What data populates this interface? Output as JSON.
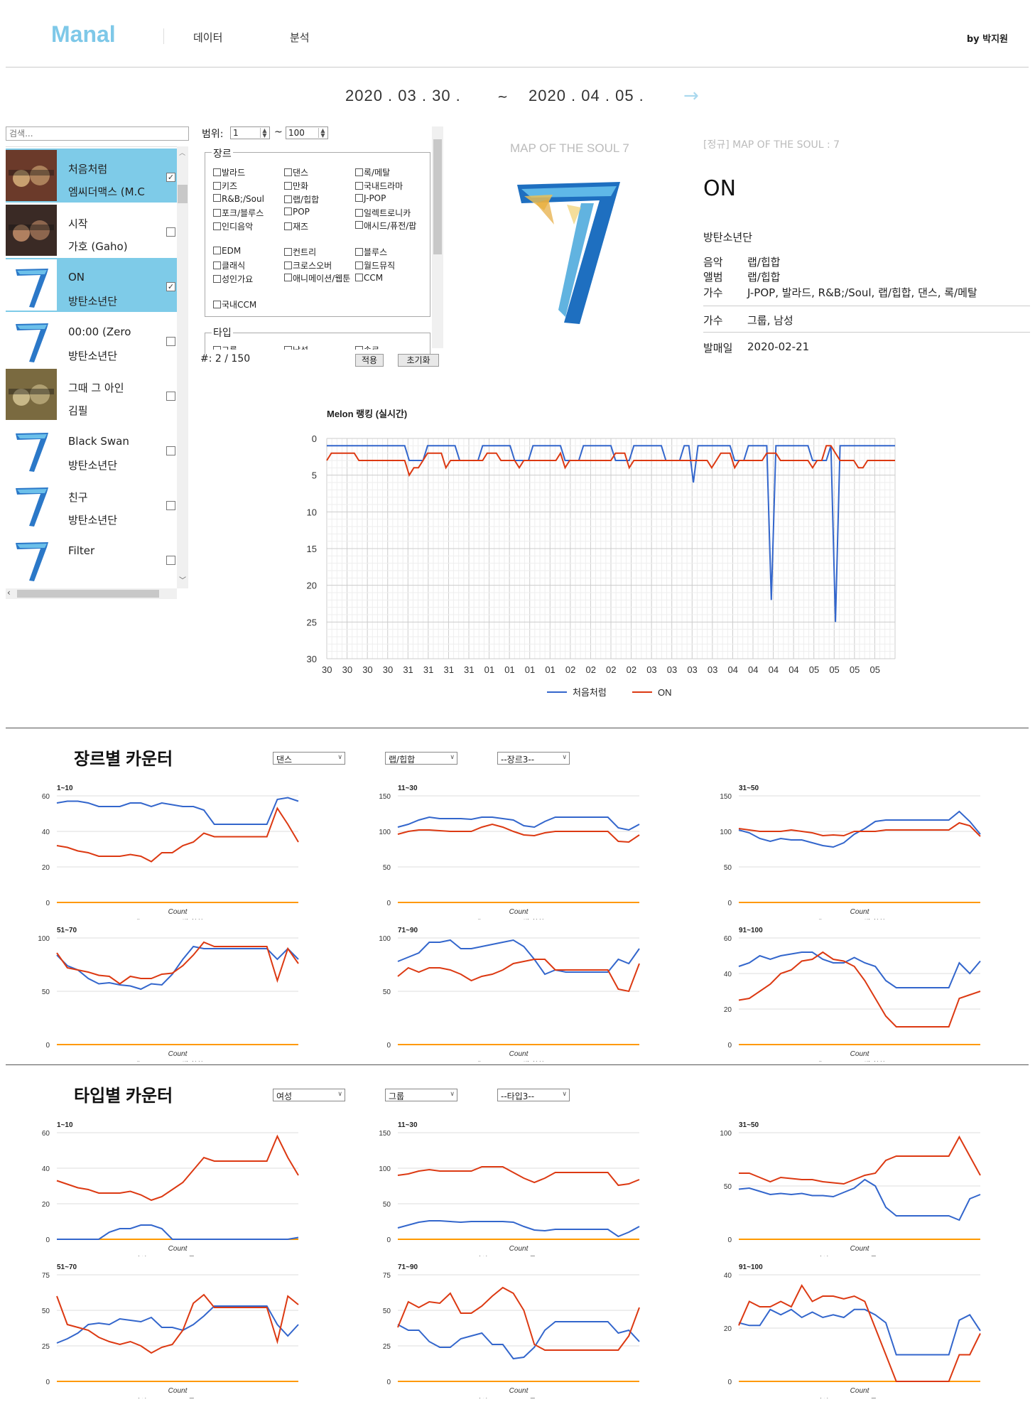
{
  "header": {
    "logo": "Manal",
    "nav": [
      "데이터",
      "분석"
    ],
    "author": "by 박지원"
  },
  "date_range": {
    "start": "2020 .  03 .  30 .",
    "separator": "~",
    "end": "2020 .  04 .  05 .",
    "arrow": "→"
  },
  "search": {
    "placeholder": "검색..."
  },
  "songs": [
    {
      "title": "처음처럼",
      "artist": "엠씨더맥스 (M.C",
      "selected": true,
      "checked": true
    },
    {
      "title": "시작",
      "artist": "가호 (Gaho)",
      "selected": false,
      "checked": false
    },
    {
      "title": "ON",
      "artist": "방탄소년단",
      "selected": true,
      "checked": true
    },
    {
      "title": "00:00 (Zero",
      "artist": "방탄소년단",
      "selected": false,
      "checked": false
    },
    {
      "title": "그때 그 아인",
      "artist": "김필",
      "selected": false,
      "checked": false
    },
    {
      "title": "Black Swan",
      "artist": "방탄소년단",
      "selected": false,
      "checked": false
    },
    {
      "title": "친구",
      "artist": "방탄소년단",
      "selected": false,
      "checked": false
    },
    {
      "title": "Filter",
      "artist": "",
      "selected": false,
      "checked": false
    }
  ],
  "filter": {
    "range_label": "범위:",
    "range_from": "1",
    "range_tilde": "~",
    "range_to": "100",
    "genre_label": "장르",
    "genres": [
      [
        "발라드",
        "댄스",
        "록/메탈"
      ],
      [
        "키즈",
        "만화",
        "국내드라마"
      ],
      [
        "R&B;/Soul",
        "랩/힙합",
        "J-POP"
      ],
      [
        "포크/블루스",
        "POP",
        "일렉트로니카"
      ],
      [
        "인디음악",
        "재즈",
        "애시드/퓨전/팝"
      ],
      [
        "EDM",
        "컨트리",
        "블루스"
      ],
      [
        "클래식",
        "크로스오버",
        "월드뮤직"
      ],
      [
        "성인가요",
        "애니메이션/웹툰",
        "CCM"
      ],
      [
        "국내CCM",
        "",
        ""
      ]
    ],
    "type_label": "타입",
    "type_partial": [
      "그룹",
      "남성",
      "솔로"
    ],
    "count": "#: 2 / 150",
    "apply": "적용",
    "reset": "초기화"
  },
  "detail": {
    "album_art_text": "MAP OF THE SOUL  7",
    "tag": "[정규] MAP OF THE SOUL : 7",
    "title": "ON",
    "artist": "방탄소년단",
    "rows": [
      {
        "k": "음악",
        "v": "랩/힙합"
      },
      {
        "k": "앨범",
        "v": "랩/힙합"
      },
      {
        "k": "가수",
        "v": "J-POP, 발라드, R&B;/Soul, 랩/힙합, 댄스, 록/메탈"
      }
    ],
    "type_row": {
      "k": "가수",
      "v": "그룹, 남성"
    },
    "release_row": {
      "k": "발매일",
      "v": "2020-02-21"
    }
  },
  "colors": {
    "blue": "#3366cc",
    "red": "#dc3912",
    "orange": "#ff9900",
    "accent": "#7ecbe8"
  },
  "chart_data": [
    {
      "id": "ranking",
      "type": "line",
      "title": "Melon 랭킹 (실시간)",
      "ylim": [
        0,
        30
      ],
      "y_inverted": true,
      "yticks": [
        0,
        5,
        10,
        15,
        20,
        25,
        30
      ],
      "xticks": [
        "30",
        "30",
        "30",
        "30",
        "31",
        "31",
        "31",
        "31",
        "01",
        "01",
        "01",
        "01",
        "02",
        "02",
        "02",
        "02",
        "03",
        "03",
        "03",
        "03",
        "04",
        "04",
        "04",
        "04",
        "05",
        "05",
        "05",
        "05"
      ],
      "series": [
        {
          "name": "처음처럼",
          "color": "#3366cc",
          "values": [
            1,
            1,
            1,
            1,
            1,
            1,
            1,
            1,
            1,
            1,
            1,
            1,
            1,
            1,
            1,
            1,
            1,
            1,
            3,
            3,
            3,
            3,
            1,
            1,
            1,
            1,
            1,
            1,
            1,
            3,
            3,
            3,
            3,
            3,
            1,
            1,
            1,
            1,
            1,
            1,
            1,
            3,
            3,
            3,
            3,
            1,
            1,
            1,
            1,
            1,
            1,
            1,
            3,
            3,
            3,
            3,
            1,
            1,
            1,
            1,
            1,
            1,
            1,
            3,
            3,
            3,
            3,
            1,
            1,
            1,
            1,
            1,
            1,
            1,
            3,
            3,
            3,
            3,
            1,
            1,
            6,
            1,
            1,
            1,
            1,
            1,
            1,
            1,
            1,
            3,
            3,
            3,
            1,
            1,
            1,
            1,
            1,
            22,
            1,
            1,
            1,
            1,
            1,
            1,
            1,
            1,
            3,
            3,
            3,
            3,
            1,
            25,
            1,
            1,
            1,
            1,
            1,
            1,
            1,
            1,
            1,
            1,
            1,
            1,
            1
          ]
        },
        {
          "name": "ON",
          "color": "#dc3912",
          "values": [
            3,
            2,
            2,
            2,
            2,
            2,
            2,
            3,
            3,
            3,
            3,
            3,
            3,
            3,
            3,
            3,
            3,
            3,
            5,
            4,
            4,
            3,
            2,
            2,
            2,
            2,
            4,
            3,
            3,
            3,
            3,
            3,
            3,
            3,
            3,
            2,
            2,
            2,
            3,
            3,
            3,
            3,
            4,
            3,
            3,
            3,
            3,
            3,
            3,
            3,
            3,
            2,
            4,
            3,
            3,
            3,
            3,
            3,
            3,
            3,
            3,
            3,
            3,
            2,
            2,
            2,
            4,
            3,
            3,
            3,
            3,
            3,
            3,
            3,
            3,
            3,
            3,
            3,
            3,
            3,
            3,
            3,
            3,
            3,
            4,
            3,
            2,
            2,
            2,
            4,
            3,
            3,
            3,
            3,
            3,
            3,
            2,
            2,
            2,
            3,
            3,
            3,
            3,
            3,
            3,
            3,
            4,
            3,
            3,
            1,
            1,
            2,
            3,
            3,
            3,
            3,
            4,
            4,
            3,
            3,
            3,
            3,
            3,
            3,
            3
          ]
        }
      ]
    }
  ],
  "genre_section": {
    "title": "장르별 카운터",
    "selects": [
      "댄스",
      "랩/힙합",
      "--장르3--"
    ],
    "legend": [
      "댄스",
      "랩/힙합",
      ""
    ],
    "xlabel": "Count",
    "charts": [
      {
        "title": "1~10",
        "ymax": 60,
        "yticks": [
          0,
          20,
          40,
          60
        ],
        "s1": [
          56,
          57,
          57,
          56,
          54,
          54,
          54,
          56,
          56,
          54,
          56,
          55,
          54,
          54,
          52,
          44,
          44,
          44,
          44,
          44,
          44,
          58,
          59,
          57
        ],
        "s2": [
          32,
          31,
          29,
          28,
          26,
          26,
          26,
          27,
          26,
          23,
          28,
          28,
          32,
          34,
          39,
          37,
          37,
          37,
          37,
          37,
          37,
          53,
          44,
          34
        ]
      },
      {
        "title": "11~30",
        "ymax": 150,
        "yticks": [
          0,
          50,
          100,
          150
        ],
        "s1": [
          106,
          110,
          116,
          120,
          118,
          118,
          118,
          117,
          120,
          120,
          118,
          116,
          108,
          106,
          114,
          120,
          120,
          120,
          120,
          120,
          120,
          105,
          102,
          110
        ],
        "s2": [
          96,
          100,
          102,
          102,
          101,
          100,
          100,
          100,
          106,
          110,
          106,
          100,
          95,
          94,
          98,
          100,
          100,
          100,
          100,
          100,
          100,
          86,
          85,
          95
        ]
      },
      {
        "title": "31~50",
        "ymax": 150,
        "yticks": [
          0,
          50,
          100,
          150
        ],
        "s1": [
          102,
          98,
          90,
          86,
          90,
          88,
          88,
          84,
          80,
          78,
          84,
          96,
          104,
          114,
          116,
          116,
          116,
          116,
          116,
          116,
          116,
          128,
          114,
          96
        ],
        "s2": [
          104,
          102,
          100,
          100,
          100,
          102,
          100,
          98,
          94,
          95,
          94,
          100,
          100,
          100,
          102,
          102,
          102,
          102,
          102,
          102,
          102,
          112,
          108,
          93
        ]
      },
      {
        "title": "51~70",
        "ymax": 100,
        "yticks": [
          0,
          50,
          100
        ],
        "s1": [
          84,
          74,
          70,
          62,
          57,
          58,
          56,
          55,
          52,
          57,
          56,
          66,
          80,
          92,
          90,
          90,
          90,
          90,
          90,
          90,
          90,
          80,
          90,
          80
        ],
        "s2": [
          86,
          72,
          70,
          68,
          65,
          64,
          57,
          64,
          62,
          62,
          66,
          67,
          74,
          84,
          96,
          92,
          92,
          92,
          92,
          92,
          92,
          60,
          90,
          76
        ]
      },
      {
        "title": "71~90",
        "ymax": 100,
        "yticks": [
          0,
          50,
          100
        ],
        "s1": [
          78,
          82,
          86,
          96,
          96,
          98,
          90,
          90,
          92,
          94,
          96,
          98,
          92,
          80,
          66,
          70,
          68,
          68,
          68,
          68,
          68,
          80,
          76,
          90
        ],
        "s2": [
          64,
          72,
          68,
          72,
          72,
          70,
          66,
          60,
          64,
          66,
          70,
          76,
          78,
          80,
          80,
          70,
          70,
          70,
          70,
          70,
          70,
          52,
          50,
          76
        ]
      },
      {
        "title": "91~100",
        "ymax": 60,
        "yticks": [
          0,
          20,
          40,
          60
        ],
        "s1": [
          44,
          46,
          50,
          48,
          50,
          51,
          52,
          52,
          48,
          46,
          46,
          49,
          46,
          44,
          36,
          32,
          32,
          32,
          32,
          32,
          32,
          46,
          40,
          47
        ],
        "s2": [
          25,
          26,
          30,
          34,
          40,
          42,
          47,
          48,
          52,
          48,
          47,
          44,
          36,
          26,
          16,
          10,
          10,
          10,
          10,
          10,
          10,
          26,
          28,
          30
        ]
      }
    ]
  },
  "type_section": {
    "title": "타입별 카운터",
    "selects": [
      "여성",
      "그룹",
      "--타입3--"
    ],
    "legend": [
      "여성",
      "그룹",
      ""
    ],
    "xlabel": "Count",
    "charts": [
      {
        "title": "1~10",
        "ymax": 60,
        "yticks": [
          0,
          20,
          40,
          60
        ],
        "s1": [
          0,
          0,
          0,
          0,
          0,
          4,
          6,
          6,
          8,
          8,
          6,
          0,
          0,
          0,
          0,
          0,
          0,
          0,
          0,
          0,
          0,
          0,
          0,
          1
        ],
        "s2": [
          33,
          31,
          29,
          28,
          26,
          26,
          26,
          27,
          25,
          22,
          24,
          28,
          32,
          39,
          46,
          44,
          44,
          44,
          44,
          44,
          44,
          58,
          46,
          36
        ]
      },
      {
        "title": "11~30",
        "ymax": 150,
        "yticks": [
          0,
          50,
          100,
          150
        ],
        "s1": [
          16,
          20,
          24,
          26,
          26,
          25,
          24,
          25,
          25,
          25,
          25,
          24,
          18,
          13,
          12,
          14,
          14,
          14,
          14,
          14,
          14,
          4,
          10,
          18
        ],
        "s2": [
          90,
          92,
          96,
          98,
          96,
          96,
          96,
          96,
          102,
          102,
          102,
          94,
          86,
          80,
          86,
          94,
          94,
          94,
          94,
          94,
          94,
          76,
          78,
          84
        ]
      },
      {
        "title": "31~50",
        "ymax": 100,
        "yticks": [
          0,
          50,
          100
        ],
        "s1": [
          47,
          48,
          45,
          42,
          43,
          42,
          43,
          41,
          41,
          40,
          44,
          48,
          56,
          50,
          30,
          22,
          22,
          22,
          22,
          22,
          22,
          18,
          38,
          42
        ],
        "s2": [
          62,
          62,
          58,
          54,
          58,
          57,
          56,
          56,
          54,
          53,
          52,
          56,
          60,
          62,
          74,
          78,
          78,
          78,
          78,
          78,
          78,
          96,
          78,
          60
        ]
      },
      {
        "title": "51~70",
        "ymax": 75,
        "yticks": [
          0,
          25,
          50,
          75
        ],
        "s1": [
          27,
          30,
          34,
          40,
          41,
          40,
          44,
          43,
          42,
          45,
          38,
          38,
          36,
          40,
          46,
          53,
          53,
          53,
          53,
          53,
          53,
          40,
          32,
          40
        ],
        "s2": [
          60,
          40,
          38,
          36,
          31,
          28,
          26,
          28,
          25,
          20,
          24,
          26,
          36,
          55,
          61,
          52,
          52,
          52,
          52,
          52,
          52,
          28,
          60,
          54
        ]
      },
      {
        "title": "71~90",
        "ymax": 75,
        "yticks": [
          0,
          25,
          50,
          75
        ],
        "s1": [
          40,
          36,
          36,
          28,
          24,
          24,
          30,
          32,
          34,
          26,
          26,
          16,
          17,
          24,
          36,
          42,
          42,
          42,
          42,
          42,
          42,
          34,
          36,
          28
        ],
        "s2": [
          38,
          56,
          52,
          56,
          55,
          62,
          48,
          48,
          53,
          60,
          66,
          62,
          50,
          26,
          22,
          22,
          22,
          22,
          22,
          22,
          22,
          22,
          32,
          52
        ]
      },
      {
        "title": "91~100",
        "ymax": 40,
        "yticks": [
          0,
          20,
          40
        ],
        "s1": [
          22,
          21,
          21,
          27,
          25,
          27,
          24,
          26,
          24,
          25,
          24,
          27,
          27,
          25,
          22,
          10,
          10,
          10,
          10,
          10,
          10,
          23,
          25,
          19
        ],
        "s2": [
          21,
          30,
          28,
          28,
          30,
          28,
          36,
          30,
          32,
          32,
          31,
          32,
          30,
          20,
          10,
          0,
          0,
          0,
          0,
          0,
          0,
          10,
          10,
          18
        ]
      }
    ]
  }
}
